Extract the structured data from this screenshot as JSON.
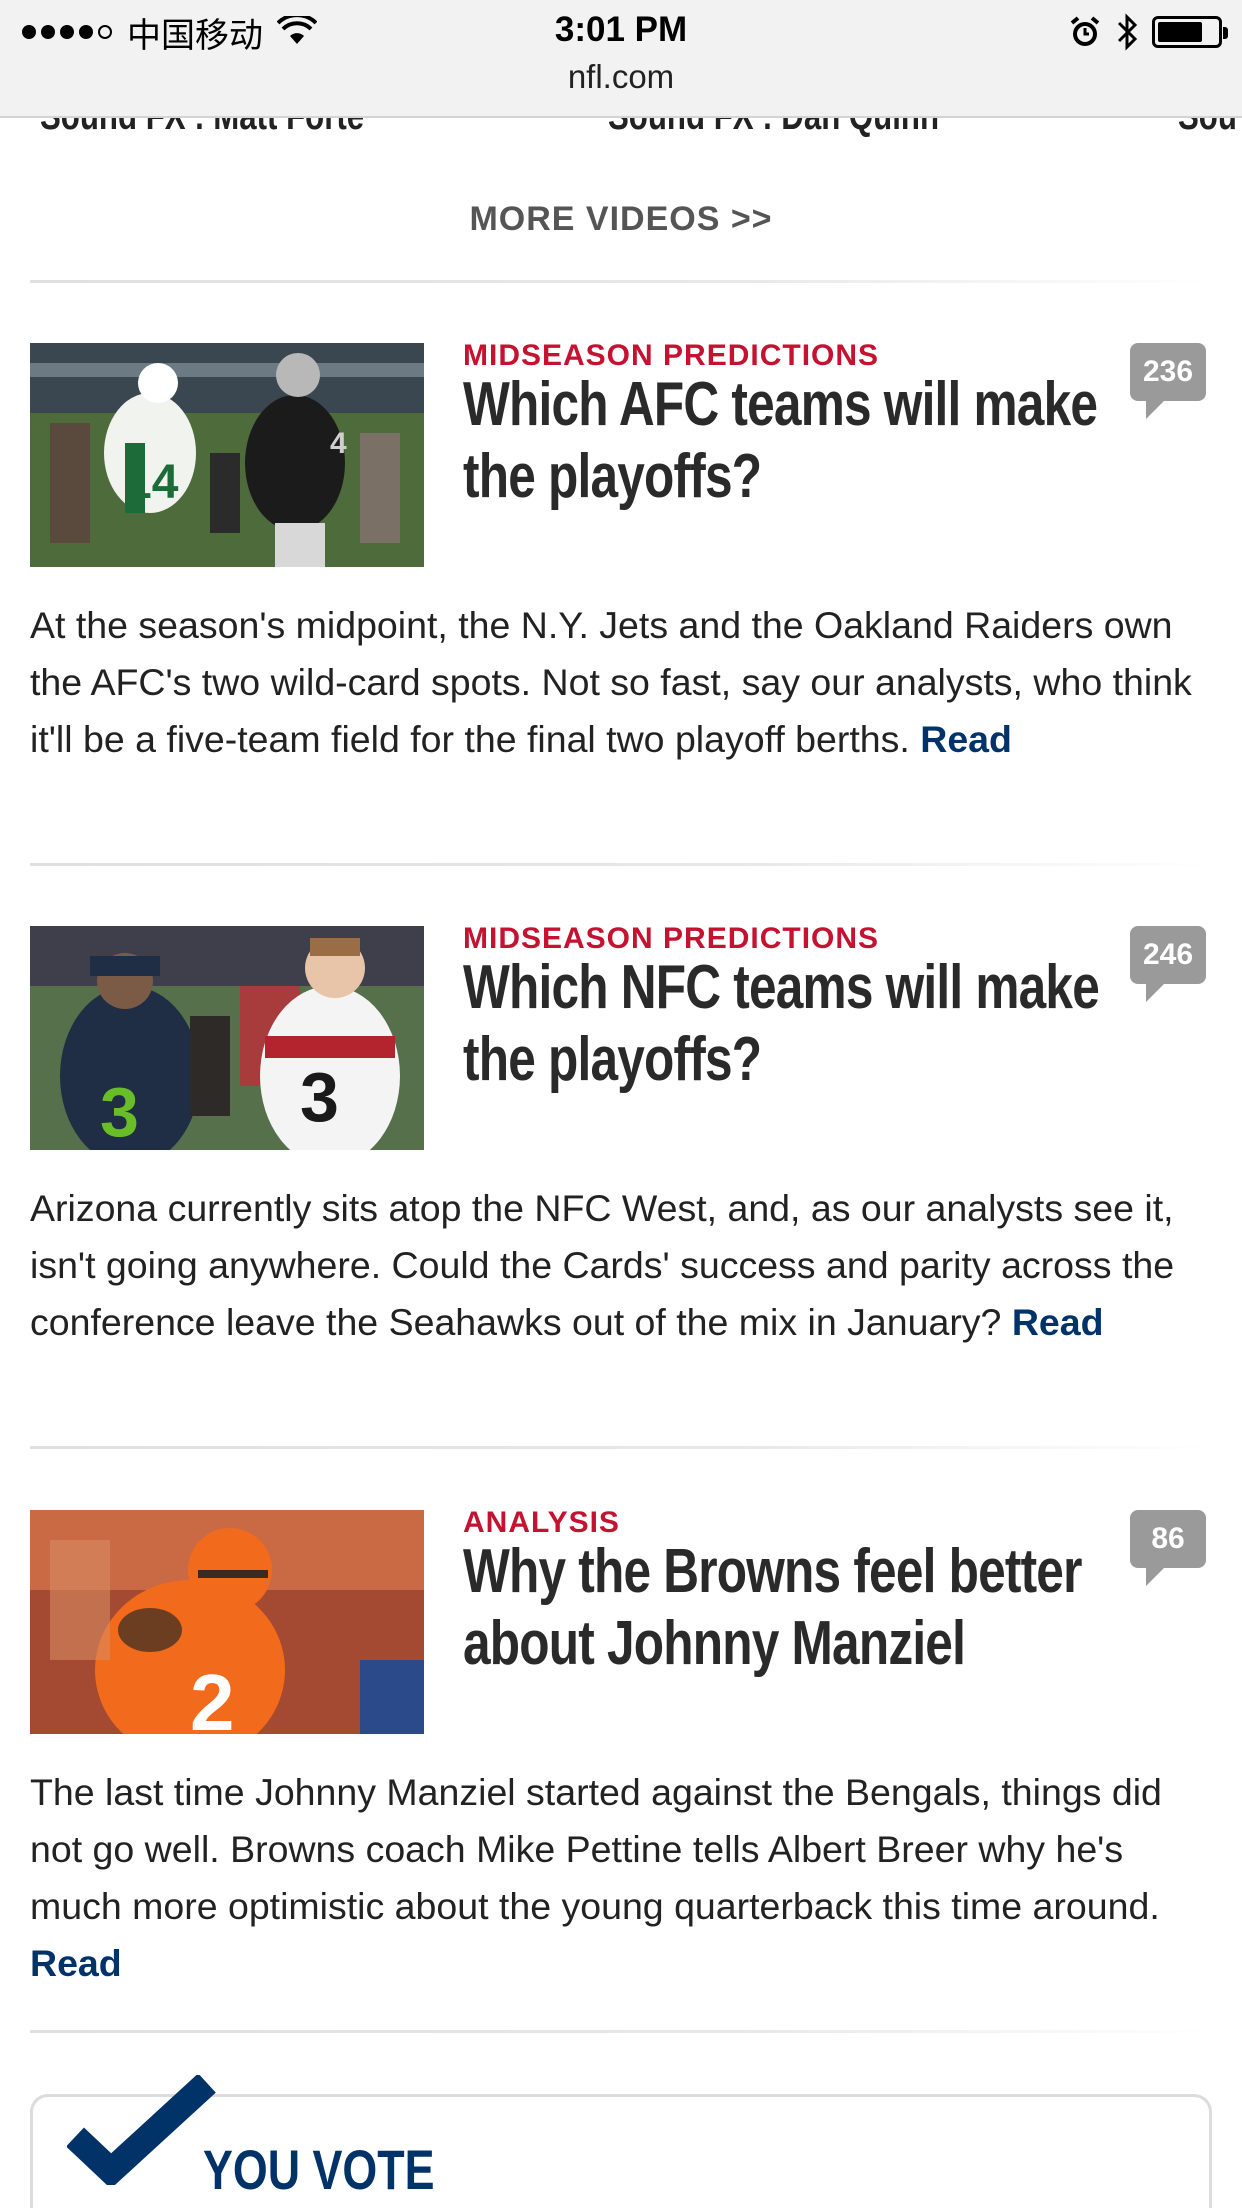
{
  "status_bar": {
    "carrier": "中国移动",
    "time": "3:01 PM",
    "url": "nfl.com",
    "battery_level": 0.78
  },
  "video_strip": {
    "items": [
      "Sound FX : Matt Forte",
      "Sound FX : Dan Quinn",
      "Sou"
    ]
  },
  "more_videos_label": "MORE VIDEOS >>",
  "articles": [
    {
      "kicker": "MIDSEASON PREDICTIONS",
      "headline": "Which AFC teams will make the playoffs?",
      "comments": "236",
      "summary": "At the season's midpoint, the N.Y. Jets and the Oakland Raiders own the AFC's two wild-card spots. Not so fast, say our analysts, who think it'll be a five-team field for the final two playoff berths.",
      "read_label": "Read"
    },
    {
      "kicker": "MIDSEASON PREDICTIONS",
      "headline": "Which NFC teams will make the playoffs?",
      "comments": "246",
      "summary": "Arizona currently sits atop the NFC West, and, as our analysts see it, isn't going anywhere. Could the Cards' success and parity across the conference leave the Seahawks out of the mix in January?",
      "read_label": "Read"
    },
    {
      "kicker": "ANALYSIS",
      "headline": "Why the Browns feel better about Johnny Manziel",
      "comments": "86",
      "summary": "The last time Johnny Manziel started against the Bengals, things did not go well. Browns coach Mike Pettine tells Albert Breer why he's much more optimistic about the young quarterback this time around.",
      "read_label": "Read"
    }
  ],
  "you_vote": {
    "label": "YOU VOTE"
  },
  "colors": {
    "kicker_red": "#c41230",
    "link_navy": "#013369",
    "bubble_gray": "#9a9a9a"
  }
}
